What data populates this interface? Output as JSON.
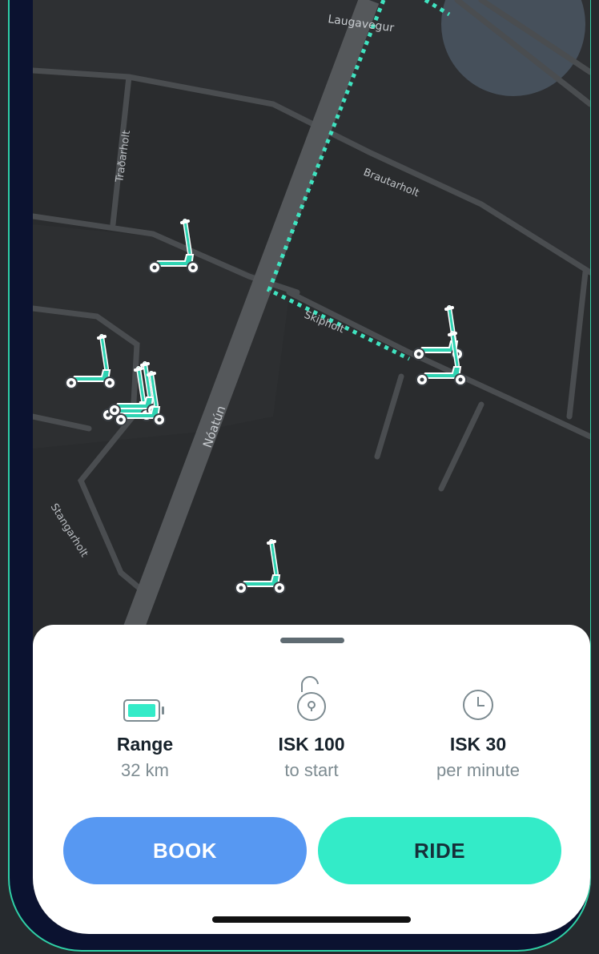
{
  "map": {
    "street_labels": [
      "Laugavegur",
      "Traðarholt",
      "Brautarholt",
      "Skipholt",
      "Nóatún",
      "Stangarholt"
    ],
    "scooter_icon": "kick-scooter-icon",
    "route_color": "#3fe3c0",
    "accent_color": "#33ebc8"
  },
  "sheet": {
    "stats": [
      {
        "icon": "battery-icon",
        "title": "Range",
        "subtitle": "32 km"
      },
      {
        "icon": "unlock-icon",
        "title": "ISK 100",
        "subtitle": "to start"
      },
      {
        "icon": "clock-icon",
        "title": "ISK 30",
        "subtitle": "per minute"
      }
    ],
    "book_label": "BOOK",
    "ride_label": "RIDE",
    "book_color": "#5798f2",
    "ride_color": "#33ebc8"
  }
}
